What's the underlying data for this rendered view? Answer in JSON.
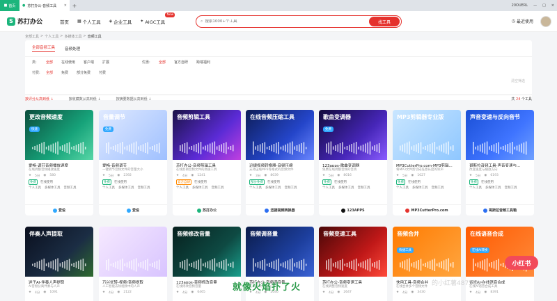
{
  "browser": {
    "home_tab": "首页",
    "active_tab": "苏打办公-音频工具",
    "tab_close": "×",
    "new_tab": "+",
    "user": "20OUERL",
    "window_min": "—",
    "window_max": "□",
    "window_close": "×"
  },
  "header": {
    "logo": "苏打办公",
    "nav": [
      {
        "label": "首页"
      },
      {
        "label": "个人工具"
      },
      {
        "label": "企业工具"
      },
      {
        "label": "AIGC工具"
      }
    ],
    "new_badge": "New",
    "search_placeholder": "搜索1000+个工具",
    "search_button": "找工具",
    "recent": "最近使用"
  },
  "breadcrumb": {
    "items": [
      "全部工具",
      "个人工具",
      "多媒体工具"
    ],
    "current": "音频工具",
    "sep": ">"
  },
  "filters": {
    "top_tabs": [
      "全部音频工具",
      "音频处理"
    ],
    "row1_label": "类:",
    "row1_options": [
      "全部",
      "在线使用",
      "客户端",
      "扩展"
    ],
    "row1_selected": 0,
    "row2_label": "优惠:",
    "row2_options": [
      "全部",
      "官方自研",
      "跨端福利"
    ],
    "row2_selected": 0,
    "row3_label": "付费:",
    "row3_options": [
      "全部",
      "免费",
      "部分免费",
      "付费"
    ],
    "row3_selected": 0,
    "reset": "清空筛选"
  },
  "sortbar": {
    "options": [
      "按评分从高到低 ↓",
      "按收藏数从高到低 ↓",
      "按摘要数据从高到低 ↓"
    ],
    "selected": 0,
    "count_prefix": "共",
    "count": "24",
    "count_suffix": "个工具"
  },
  "cards_row1": [
    {
      "thumb_title": "更改音频速度",
      "thumb_tag": "快速",
      "title": "爱畅-调节音频播放速度",
      "desc": "在线调整音频播放速度",
      "rating": "5分",
      "views": "580",
      "tag1": "免费",
      "tag2": "在线使用",
      "cats": [
        "个人工具",
        "多媒体工具",
        "音频工具"
      ],
      "footer": "爱设"
    },
    {
      "thumb_title": "音量调节",
      "thumb_tag": "免费",
      "title": "爱畅-音频调节",
      "desc": "一键调节音频文件的音量大小",
      "rating": "5分",
      "views": "2392",
      "tag1": "免费",
      "tag2": "在线使用",
      "cats": [
        "个人工具",
        "多媒体工具",
        "音频工具"
      ],
      "footer": "爱设"
    },
    {
      "thumb_title": "音频剪辑工具",
      "thumb_tag": "",
      "title": "苏打办公-音频剪辑工具",
      "desc": "在线剪辑音频文件的高级工具",
      "rating": "4分",
      "views": "1241",
      "tag1": "官方自研",
      "tag2": "在线使用",
      "cats": [
        "个人工具",
        "多媒体工具",
        "音频工具"
      ],
      "footer": "苏打办公"
    },
    {
      "thumb_title": "在线音频压缩工具",
      "thumb_tag": "",
      "title": "迅捷视频转换器-音频压缩",
      "desc": "支持压缩MP3等格式的音频文件",
      "rating": "3分",
      "views": "8039",
      "tag1": "部分免费",
      "tag2": "在线使用",
      "cats": [
        "个人工具",
        "多媒体工具",
        "音频工具"
      ],
      "footer": "迅捷视频转换器"
    },
    {
      "thumb_title": "歌曲变调器",
      "thumb_tag": "免费",
      "title": "123apps-歌曲变调器",
      "desc": "免费在线调整音频的音高",
      "rating": "5分",
      "views": "8016",
      "tag1": "免费",
      "tag2": "在线使用",
      "cats": [
        "个人工具",
        "多媒体工具",
        "音频工具"
      ],
      "footer": "123APPS"
    },
    {
      "thumb_title": "MP3剪辑器专业版",
      "thumb_tag": "",
      "title": "MP3CutterPro.com-MP3剪辑...",
      "desc": "将MP3文件剪切成任意长度的铃声",
      "rating": "5分",
      "views": "1027",
      "tag1": "免费",
      "tag2": "在线使用",
      "cats": [
        "个人工具",
        "多媒体工具",
        "音频工具"
      ],
      "footer": "MP3CutterPro.com"
    },
    {
      "thumb_title": "声音变速与反向音节",
      "thumb_tag": "",
      "title": "哥斯拉音频工具-声音变速与...",
      "desc": "改变速度与播放方向",
      "rating": "5分",
      "views": "6193",
      "tag1": "免费",
      "tag2": "在线使用",
      "cats": [
        "个人工具",
        "多媒体工具",
        "音频工具"
      ],
      "footer": "哥斯拉音频工具箱"
    }
  ],
  "cards_row2": [
    {
      "thumb_title": "伴奏人声提取",
      "thumb_tag": "",
      "title": "迷子AI-伴奏人声提取",
      "desc": "AI音频分离伴奏与人声",
      "rating": "4分",
      "views": "1091"
    },
    {
      "thumb_title": "",
      "thumb_tag": "",
      "title": "万兴优转-视频/音频提取",
      "desc": "人工智能去除视频中的人声",
      "rating": "4分",
      "views": "2122"
    },
    {
      "thumb_title": "音频修改音量",
      "thumb_tag": "",
      "title": "123apps-音频修改音量",
      "desc": "在线修改音频音量",
      "rating": "4分",
      "views": "6465"
    },
    {
      "thumb_title": "音频调音量",
      "thumb_tag": "",
      "title": "苏打办公-音频调音量",
      "desc": "在线修改音量大小",
      "rating": "4分",
      "views": "2040"
    },
    {
      "thumb_title": "音频变速工具",
      "thumb_tag": "",
      "title": "苏打办公-音频变速工具",
      "desc": "在线调整音频速度",
      "rating": "4分",
      "views": "2647"
    },
    {
      "thumb_title": "音频合并",
      "thumb_tag": "快捷工具",
      "title": "快用工具-音频合并",
      "desc": "在线合并多个音频文件",
      "rating": "4分",
      "views": "3430"
    },
    {
      "thumb_title": "在线语音合成",
      "thumb_tag": "在线AI转换",
      "title": "音修AI-在线语音合成",
      "desc": "在线AI语音合成工具",
      "rating": "4分",
      "views": "8391"
    }
  ],
  "watermark": {
    "subtitle": "就像火焰扑了火",
    "brand": "小红书",
    "id": "的小红薯4875619"
  },
  "colors": {
    "accent": "#e5322d",
    "brand": "#1cb57c"
  }
}
